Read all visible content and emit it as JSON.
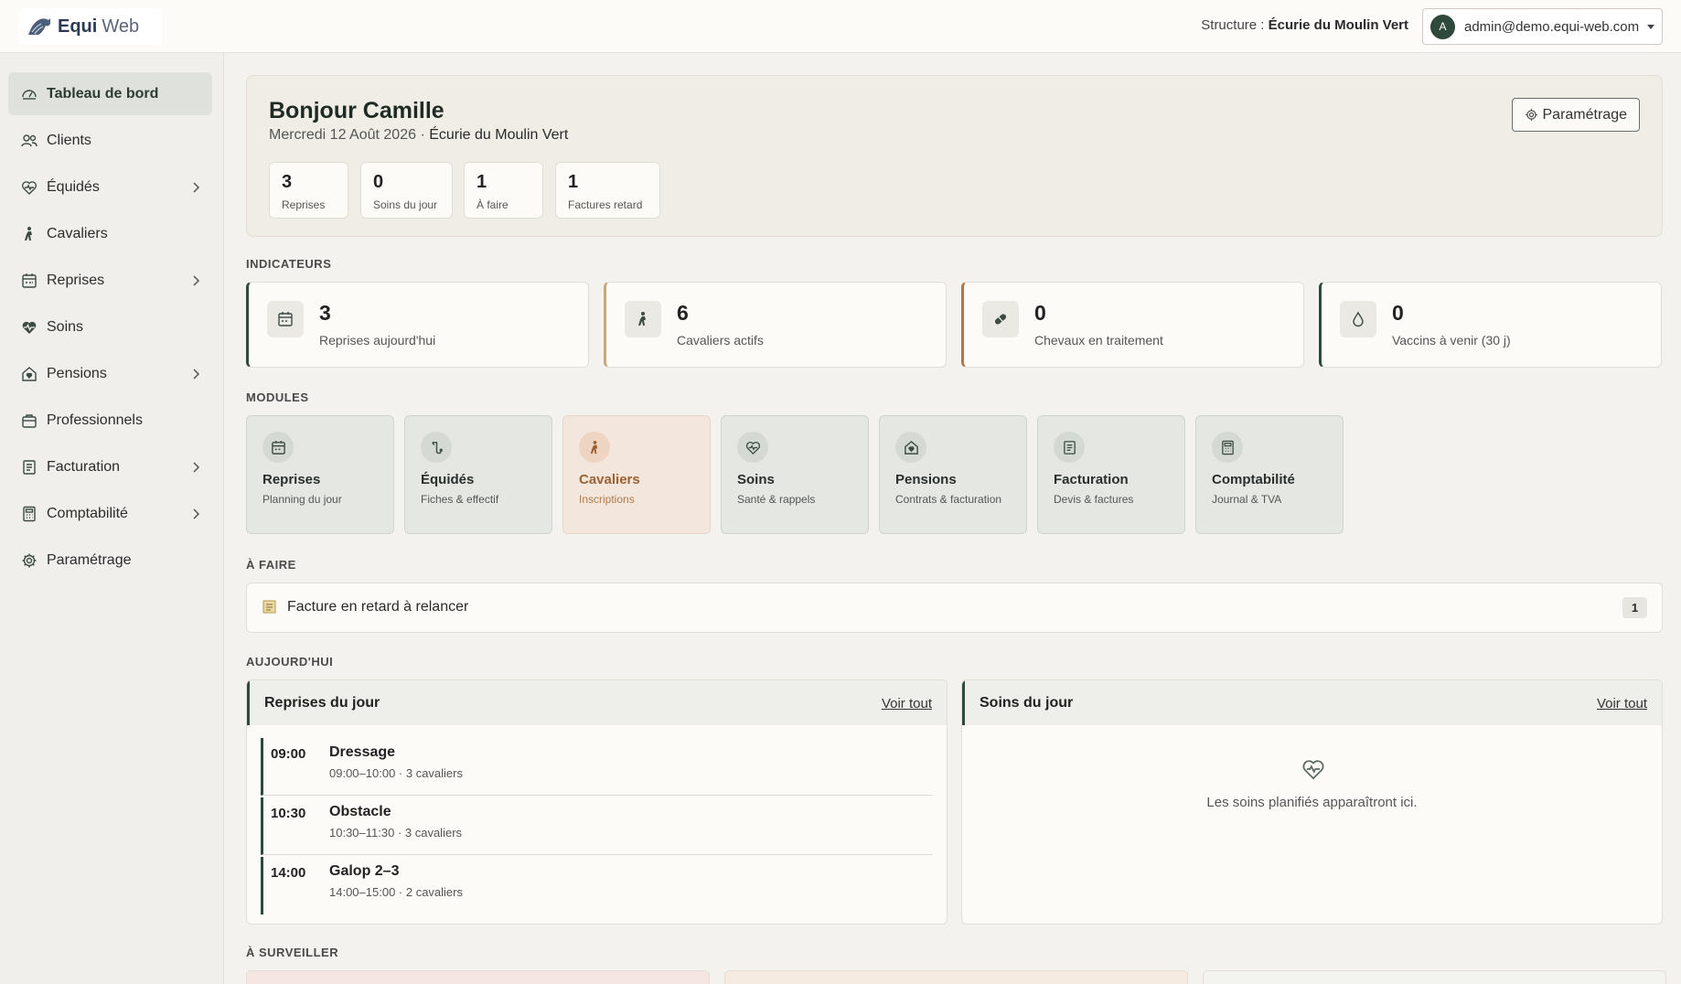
{
  "header": {
    "logo_primary": "Equi",
    "logo_secondary": "Web",
    "structure_label": "Structure :",
    "structure_name": "Écurie du Moulin Vert",
    "avatar_initial": "A",
    "account_email": "admin@demo.equi-web.com"
  },
  "sidebar": {
    "items": [
      {
        "label": "Tableau de bord",
        "icon": "dashboard-icon",
        "active": true
      },
      {
        "label": "Clients",
        "icon": "users-icon"
      },
      {
        "label": "Équidés",
        "icon": "horse-heart-icon",
        "expandable": true
      },
      {
        "label": "Cavaliers",
        "icon": "rider-icon"
      },
      {
        "label": "Reprises",
        "icon": "calendar-icon",
        "expandable": true
      },
      {
        "label": "Soins",
        "icon": "heartbeat-icon"
      },
      {
        "label": "Pensions",
        "icon": "house-heart-icon",
        "expandable": true
      },
      {
        "label": "Professionnels",
        "icon": "briefcase-icon"
      },
      {
        "label": "Facturation",
        "icon": "invoice-icon",
        "expandable": true
      },
      {
        "label": "Comptabilité",
        "icon": "calculator-icon",
        "expandable": true
      },
      {
        "label": "Paramétrage",
        "icon": "gear-icon"
      }
    ]
  },
  "welcome": {
    "title": "Bonjour Camille",
    "date": "Mercredi 12 Août 2026 ·",
    "structure": "Écurie du Moulin Vert",
    "settings_button": "Paramétrage",
    "stats": [
      {
        "value": "3",
        "label": "Reprises"
      },
      {
        "value": "0",
        "label": "Soins du jour"
      },
      {
        "value": "1",
        "label": "À faire"
      },
      {
        "value": "1",
        "label": "Factures retard"
      }
    ]
  },
  "indicators": {
    "title": "Indicateurs",
    "items": [
      {
        "value": "3",
        "label": "Reprises aujourd'hui",
        "icon": "calendar-icon",
        "accent": "#2f4a3c"
      },
      {
        "value": "6",
        "label": "Cavaliers actifs",
        "icon": "rider-icon",
        "accent": "#c9a77a"
      },
      {
        "value": "0",
        "label": "Chevaux en traitement",
        "icon": "pill-icon",
        "accent": "#b8763e"
      },
      {
        "value": "0",
        "label": "Vaccins à venir (30 j)",
        "icon": "drop-icon",
        "accent": "#2f4a3c"
      }
    ]
  },
  "modules": {
    "title": "Modules",
    "items": [
      {
        "title": "Reprises",
        "subtitle": "Planning du jour",
        "icon": "calendar-icon"
      },
      {
        "title": "Équidés",
        "subtitle": "Fiches & effectif",
        "icon": "horse-icon"
      },
      {
        "title": "Cavaliers",
        "subtitle": "Inscriptions",
        "icon": "rider-icon",
        "highlight": true
      },
      {
        "title": "Soins",
        "subtitle": "Santé & rappels",
        "icon": "heartbeat-icon"
      },
      {
        "title": "Pensions",
        "subtitle": "Contrats & facturation",
        "icon": "house-heart-icon"
      },
      {
        "title": "Facturation",
        "subtitle": "Devis & factures",
        "icon": "invoice-icon"
      },
      {
        "title": "Comptabilité",
        "subtitle": "Journal & TVA",
        "icon": "calculator-icon"
      }
    ]
  },
  "todo": {
    "title": "À faire",
    "items": [
      {
        "label": "Facture en retard à relancer",
        "count": "1",
        "icon": "invoice-icon"
      }
    ]
  },
  "today": {
    "title": "Aujourd'hui",
    "sessions_panel": {
      "title": "Reprises du jour",
      "link": "Voir tout",
      "sessions": [
        {
          "time": "09:00",
          "name": "Dressage",
          "meta": "09:00–10:00 · 3 cavaliers"
        },
        {
          "time": "10:30",
          "name": "Obstacle",
          "meta": "10:30–11:30 · 3 cavaliers"
        },
        {
          "time": "14:00",
          "name": "Galop 2–3",
          "meta": "14:00–15:00 · 2 cavaliers"
        }
      ]
    },
    "care_panel": {
      "title": "Soins du jour",
      "link": "Voir tout",
      "empty_text": "Les soins planifiés apparaîtront ici."
    }
  },
  "watch": {
    "title": "À surveiller"
  },
  "colors": {
    "primary": "#2f4a3c",
    "highlight": "#b8763e",
    "background": "#f4f2ee"
  }
}
